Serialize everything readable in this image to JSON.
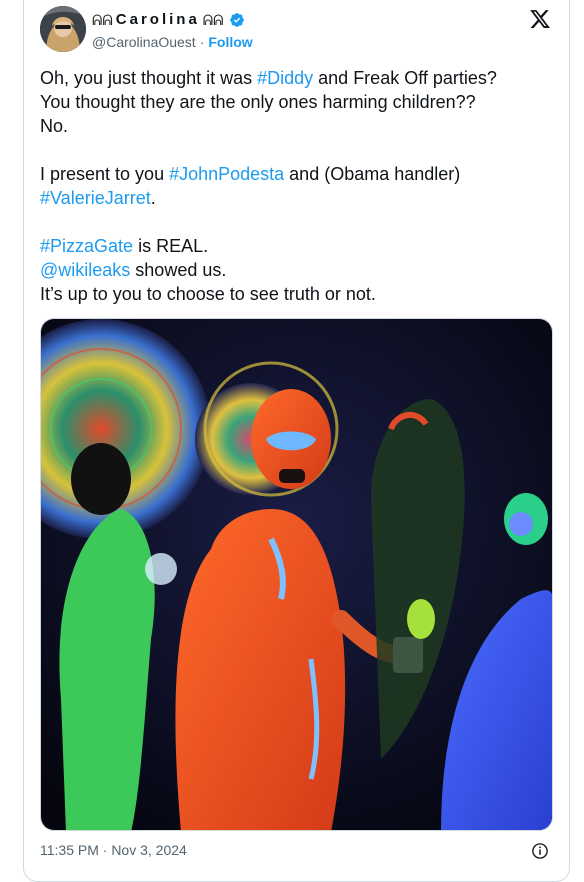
{
  "author": {
    "display_name": "Carolina",
    "handle": "@CarolinaOuest",
    "separator": "·",
    "follow_label": "Follow",
    "deco_left": "ᕱᕱ",
    "deco_right": "ᕱᕱ"
  },
  "tweet": {
    "line1_a": "Oh, you just thought it was ",
    "line1_tag": "#Diddy",
    "line1_b": " and Freak Off parties?",
    "line2": "You thought they are the only ones harming children??",
    "line3": "No.",
    "line4_a": "I present to you ",
    "line4_tag": "#JohnPodesta",
    "line4_b": " and (Obama handler)",
    "line5_tag": "#ValerieJarret",
    "line5_b": ".",
    "line6_tag": "#PizzaGate",
    "line6_b": " is REAL.",
    "line7_tag": "@wikileaks",
    "line7_b": " showed us.",
    "line8": "It’s up to you to choose to see truth or not."
  },
  "footer": {
    "timestamp": "11:35 PM · Nov 3, 2024"
  },
  "colors": {
    "link": "#1d9bf0",
    "text": "#0f1419",
    "muted": "#536471",
    "border": "#cfd9de"
  }
}
